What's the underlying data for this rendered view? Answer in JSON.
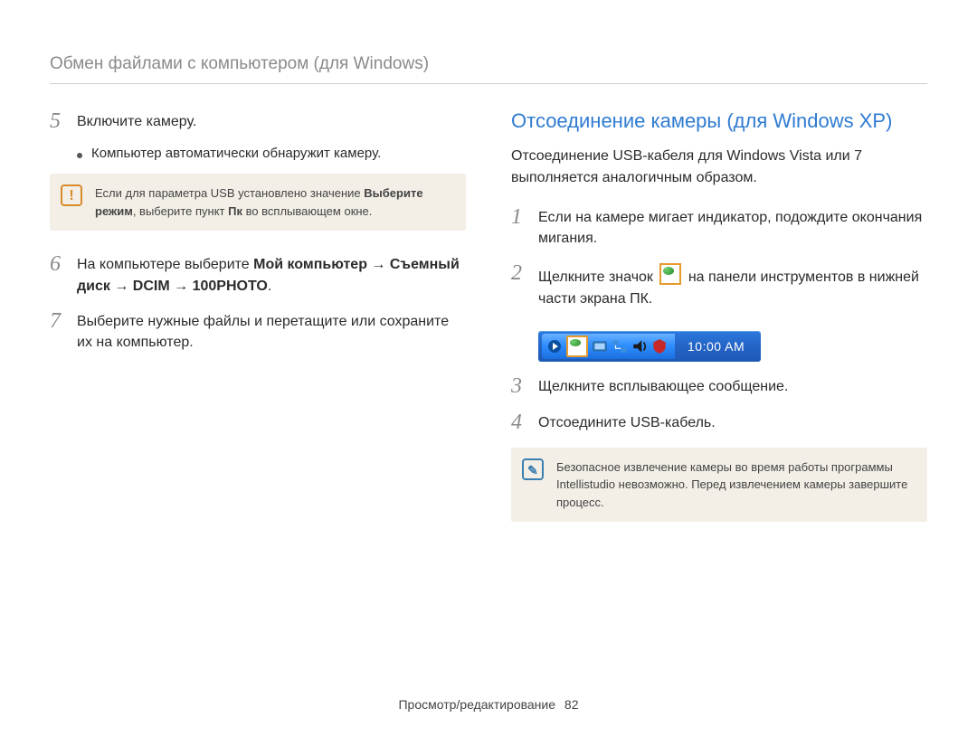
{
  "header": "Обмен файлами с компьютером (для Windows)",
  "left": {
    "step5": {
      "num": "5",
      "title": "Включите камеру.",
      "bullet": "Компьютер автоматически обнаружит камеру."
    },
    "warning": {
      "pre": "Если для параметра USB установлено значение ",
      "bold1": "Выберите режим",
      "mid": ", выберите пункт ",
      "bold2": "Пк",
      "post": " во всплывающем окне."
    },
    "step6": {
      "num": "6",
      "pre": "На компьютере выберите ",
      "bold1": "Мой компьютер",
      "arrow": " → ",
      "bold2": "Съемный диск",
      "bold3": "DCIM",
      "bold4": "100PHOTO",
      "post": "."
    },
    "step7": {
      "num": "7",
      "text": "Выберите нужные файлы и перетащите или сохраните их на компьютер."
    }
  },
  "right": {
    "title": "Отсоединение камеры (для Windows XP)",
    "intro": "Отсоединение USB-кабеля для Windows Vista или 7 выполняется аналогичным образом.",
    "step1": {
      "num": "1",
      "text": "Если на камере мигает индикатор, подождите окончания мигания."
    },
    "step2": {
      "num": "2",
      "pre": "Щелкните значок ",
      "post": " на панели инструментов в нижней части экрана ПК."
    },
    "taskbar_time": "10:00 AM",
    "step3": {
      "num": "3",
      "text": "Щелкните всплывающее сообщение."
    },
    "step4": {
      "num": "4",
      "text": "Отсоедините USB-кабель."
    },
    "info_note": "Безопасное извлечение камеры во время работы программы Intellistudio невозможно. Перед извлечением камеры завершите процесс."
  },
  "footer": {
    "section": "Просмотр/редактирование",
    "page": "82"
  }
}
